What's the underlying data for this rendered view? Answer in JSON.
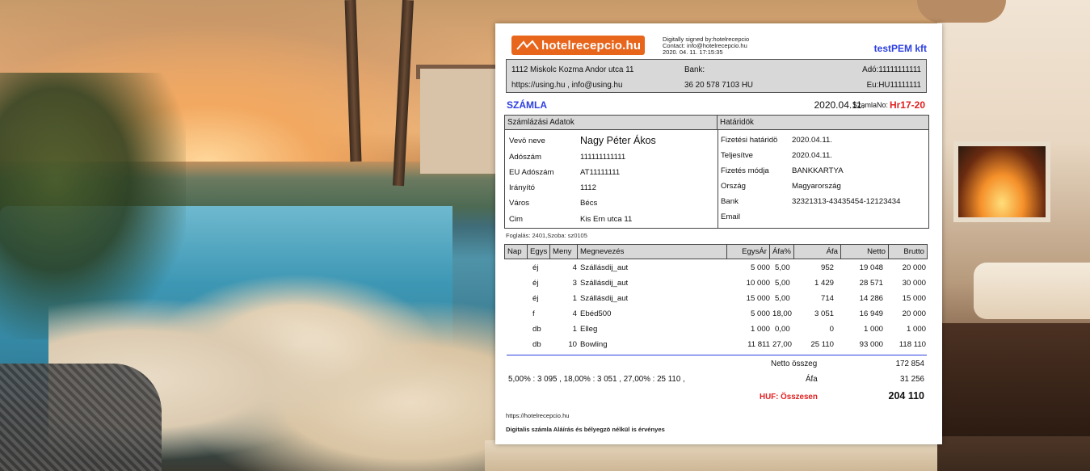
{
  "header": {
    "logo_text": "hotelrecepcio.hu",
    "signature_lines": [
      "Digitally signed by:hotelrecepcio",
      "Contact: info@hotelrecepcio.hu",
      "2020. 04. 11. 17:15:35"
    ],
    "company": "testPEM kft"
  },
  "seller": {
    "address": "1112 Miskolc Kozma Andor utca 11",
    "web": "https://using.hu , info@using.hu",
    "bank_label": "Bank:",
    "phone": "36 20 578 7103  HU",
    "tax": "Adó:11111111111",
    "eu_tax": "Eu:HU11111111"
  },
  "invoice": {
    "title": "SZÁMLA",
    "date": "2020.04.11.",
    "number_label": "SzamlaNo:",
    "number": "Hr17-20"
  },
  "billing": {
    "header": "Számlázási Adatok",
    "fields": [
      {
        "label": "Vevö neve",
        "value": "Nagy Péter Ákos"
      },
      {
        "label": "Adószám",
        "value": "111111111111"
      },
      {
        "label": "EU Adószám",
        "value": "AT11111111"
      },
      {
        "label": "Irányító",
        "value": "1112"
      },
      {
        "label": "Város",
        "value": "Bécs"
      },
      {
        "label": "Cim",
        "value": "Kis Ern utca 11"
      }
    ]
  },
  "deadlines": {
    "header": "Határidök",
    "fields": [
      {
        "label": "Fizetési határidö",
        "value": "2020.04.11."
      },
      {
        "label": "Teljesítve",
        "value": "2020.04.11."
      },
      {
        "label": "Fizetés módja",
        "value": "BANKKARTYA"
      },
      {
        "label": "Ország",
        "value": "Magyarország"
      },
      {
        "label": "Bank",
        "value": "32321313-43435454-12123434"
      },
      {
        "label": "Email",
        "value": ""
      }
    ]
  },
  "booking": "Foglalás: 2401,Szoba: sz0105",
  "table": {
    "columns": [
      "Nap",
      "Egys",
      "Meny",
      "Megnevezés",
      "EgysÁr",
      "Áfa%",
      "Áfa",
      "Netto",
      "Brutto"
    ],
    "rows": [
      {
        "nap": "",
        "egys": "éj",
        "meny": "4",
        "name": "Szállásdij_aut",
        "price": "5 000",
        "vat_pct": "5,00",
        "vat": "952",
        "net": "19 048",
        "gross": "20 000"
      },
      {
        "nap": "",
        "egys": "éj",
        "meny": "3",
        "name": "Szállásdij_aut",
        "price": "10 000",
        "vat_pct": "5,00",
        "vat": "1 429",
        "net": "28 571",
        "gross": "30 000"
      },
      {
        "nap": "",
        "egys": "éj",
        "meny": "1",
        "name": "Szállásdij_aut",
        "price": "15 000",
        "vat_pct": "5,00",
        "vat": "714",
        "net": "14 286",
        "gross": "15 000"
      },
      {
        "nap": "",
        "egys": "f",
        "meny": "4",
        "name": "Ebéd500",
        "price": "5 000",
        "vat_pct": "18,00",
        "vat": "3 051",
        "net": "16 949",
        "gross": "20 000"
      },
      {
        "nap": "",
        "egys": "db",
        "meny": "1",
        "name": "Elleg",
        "price": "1 000",
        "vat_pct": "0,00",
        "vat": "0",
        "net": "1 000",
        "gross": "1 000"
      },
      {
        "nap": "",
        "egys": "db",
        "meny": "10",
        "name": "Bowling",
        "price": "11 811",
        "vat_pct": "27,00",
        "vat": "25 110",
        "net": "93 000",
        "gross": "118 110"
      }
    ]
  },
  "totals": {
    "net_label": "Netto összeg",
    "net": "172 854",
    "vat_breakdown": "5,00% : 3 095 , 18,00% : 3 051 , 27,00% : 25 110 ,",
    "vat_label": "Áfa",
    "vat": "31 256",
    "total_label": "HUF: Összesen",
    "total": "204 110"
  },
  "footer": {
    "url": "https://hotelrecepcio.hu",
    "note": "Digitalis számla Aláírás és bélyegzö nélkül is érvényes"
  },
  "colors": {
    "accent_blue": "#2c3fe0",
    "accent_red": "#e02020",
    "logo_orange": "#e8651c",
    "header_gray": "#d8d8d8"
  }
}
